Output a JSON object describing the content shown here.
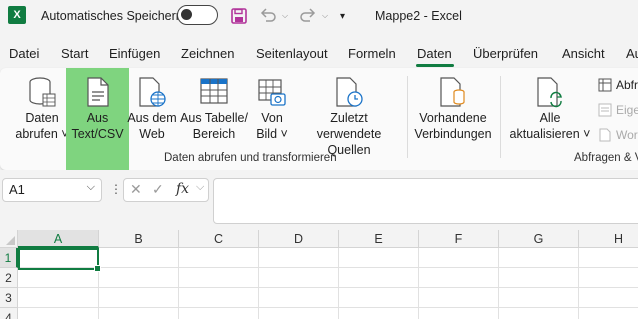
{
  "titlebar": {
    "logo_letter": "X",
    "autosave_label": "Automatisches Speichern",
    "autosave_on": false,
    "undo_dropdown": "⌵",
    "redo_dropdown": "⌵",
    "qat_dropdown": "▾",
    "document_title": "Mappe2  -  Excel"
  },
  "menu": {
    "tabs": [
      "Datei",
      "Start",
      "Einfügen",
      "Zeichnen",
      "Seitenlayout",
      "Formeln",
      "Daten",
      "Überprüfen",
      "Ansicht",
      "Au"
    ],
    "active_tab": "Daten"
  },
  "ribbon": {
    "buttons": [
      {
        "label_line1": "Daten",
        "label_line2": "abrufen ˅",
        "icon": "database-icon"
      },
      {
        "label_line1": "Aus",
        "label_line2": "Text/CSV",
        "icon": "text-file-icon"
      },
      {
        "label_line1": "Aus dem",
        "label_line2": "Web",
        "icon": "web-file-icon"
      },
      {
        "label_line1": "Aus Tabelle/",
        "label_line2": "Bereich",
        "icon": "table-icon"
      },
      {
        "label_line1": "Von",
        "label_line2": "Bild ˅",
        "icon": "picture-icon"
      },
      {
        "label_line1": "Zuletzt verwendete",
        "label_line2": "Quellen",
        "icon": "recent-sources-icon"
      },
      {
        "label_line1": "Vorhandene",
        "label_line2": "Verbindungen",
        "icon": "existing-connections-icon"
      },
      {
        "label_line1": "Alle",
        "label_line2": "aktualisieren ˅",
        "icon": "refresh-all-icon"
      }
    ],
    "group1_label": "Daten abrufen und transformieren",
    "group2_label": "Abfragen & V",
    "small_items": [
      "Abfr",
      "Eige",
      "Wor"
    ],
    "accent": "#107c41",
    "highlight": "#7fd47f"
  },
  "formula_bar": {
    "name_box": "A1",
    "name_box_chevron": "⌵",
    "dots": "⋮",
    "cancel_symbol": "✕",
    "enter_symbol": "✓",
    "fx_label": "fx",
    "fx_chevron": "⌵",
    "formula": ""
  },
  "sheet": {
    "columns": [
      "A",
      "B",
      "C",
      "D",
      "E",
      "F",
      "G",
      "H"
    ],
    "rows": [
      "1",
      "2",
      "3",
      "4"
    ],
    "active_cell": "A1"
  }
}
